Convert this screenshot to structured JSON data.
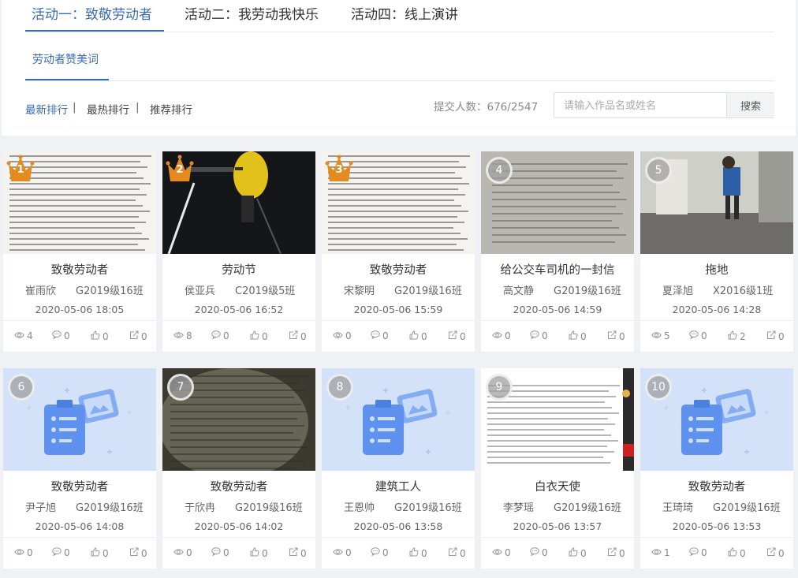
{
  "tabs": [
    {
      "label": "活动一：致敬劳动者",
      "active": true
    },
    {
      "label": "活动二：我劳动我快乐",
      "active": false
    },
    {
      "label": "活动四：线上演讲",
      "active": false
    }
  ],
  "subtab": {
    "label": "劳动者赞美词"
  },
  "sorts": [
    {
      "label": "最新排行",
      "active": true
    },
    {
      "label": "最热排行",
      "active": false
    },
    {
      "label": "推荐排行",
      "active": false
    }
  ],
  "sort_separator": "|",
  "count_text": "提交人数：676/2547",
  "search": {
    "placeholder": "请输入作品名或姓名",
    "button": "搜索"
  },
  "accent_color": "#3a6cb3",
  "cards": [
    {
      "rank": "1",
      "title": "致敬劳动者",
      "name": "崔雨欣",
      "class": "G2019级16班",
      "date": "2020-05-06 18:05",
      "views": "4",
      "comments": "0",
      "likes": "0",
      "shares": "0",
      "thumb": "document"
    },
    {
      "rank": "2",
      "title": "劳动节",
      "name": "侯亚兵",
      "class": "C2019级5班",
      "date": "2020-05-06 16:52",
      "views": "8",
      "comments": "0",
      "likes": "0",
      "shares": "0",
      "thumb": "night-photo"
    },
    {
      "rank": "3",
      "title": "致敬劳动者",
      "name": "宋黎明",
      "class": "G2019级16班",
      "date": "2020-05-06 15:59",
      "views": "0",
      "comments": "0",
      "likes": "0",
      "shares": "0",
      "thumb": "document"
    },
    {
      "rank": "4",
      "title": "给公交车司机的一封信",
      "name": "高文静",
      "class": "G2019级16班",
      "date": "2020-05-06 14:59",
      "views": "0",
      "comments": "0",
      "likes": "0",
      "shares": "0",
      "thumb": "handwriting"
    },
    {
      "rank": "5",
      "title": "拖地",
      "name": "夏泽旭",
      "class": "X2016级1班",
      "date": "2020-05-06 14:28",
      "views": "5",
      "comments": "0",
      "likes": "2",
      "shares": "0",
      "thumb": "room-photo"
    },
    {
      "rank": "6",
      "title": "致敬劳动者",
      "name": "尹子旭",
      "class": "G2019级16班",
      "date": "2020-05-06 14:08",
      "views": "0",
      "comments": "0",
      "likes": "0",
      "shares": "0",
      "thumb": "placeholder"
    },
    {
      "rank": "7",
      "title": "致敬劳动者",
      "name": "于欣冉",
      "class": "G2019级16班",
      "date": "2020-05-06 14:02",
      "views": "0",
      "comments": "0",
      "likes": "0",
      "shares": "0",
      "thumb": "dark-paper"
    },
    {
      "rank": "8",
      "title": "建筑工人",
      "name": "王恩帅",
      "class": "G2019级16班",
      "date": "2020-05-06 13:58",
      "views": "0",
      "comments": "0",
      "likes": "0",
      "shares": "0",
      "thumb": "placeholder"
    },
    {
      "rank": "9",
      "title": "白衣天使",
      "name": "李梦瑶",
      "class": "G2019级16班",
      "date": "2020-05-06 13:57",
      "views": "0",
      "comments": "0",
      "likes": "0",
      "shares": "0",
      "thumb": "screen-doc"
    },
    {
      "rank": "10",
      "title": "致敬劳动者",
      "name": "王琦琦",
      "class": "G2019级16班",
      "date": "2020-05-06 13:53",
      "views": "1",
      "comments": "0",
      "likes": "0",
      "shares": "0",
      "thumb": "placeholder"
    }
  ]
}
